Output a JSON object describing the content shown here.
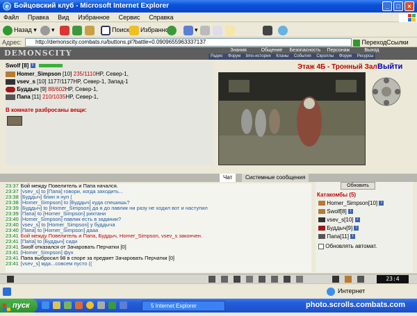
{
  "window": {
    "title": "Бойцовский клуб - Microsoft Internet Explorer"
  },
  "menu": [
    "Файл",
    "Правка",
    "Вид",
    "Избранное",
    "Сервис",
    "Справка"
  ],
  "toolbar": {
    "back_label": "Назад",
    "search_label": "Поиск",
    "favorites_label": "Избранное"
  },
  "address": {
    "label": "Адрес:",
    "url": "http://demonscity.combats.ru/buttons.pl?battle=0.0909655963337137",
    "go_label": "Переход",
    "links_label": "Ссылки"
  },
  "game_nav": {
    "logo": "DEMONSCITY",
    "top_links": [
      "Знания",
      "Общение",
      "Безопасность",
      "Персонаж",
      "Выход"
    ],
    "bottom_links": [
      "Радио",
      "Форум",
      "bms-история",
      "Кланы",
      "События",
      "Скроллы",
      "Форум",
      "Ресурсы"
    ]
  },
  "location": {
    "title": "Этаж 4Б - Тронный Зал",
    "exit_label": "Выйти"
  },
  "party": {
    "header_name": "Swolf [8]",
    "members": [
      {
        "name": "Homer_Simpson",
        "level": "[10]",
        "hp": "235/1110",
        "hp_suffix": "HP, Север-1,",
        "hp_low": true
      },
      {
        "name": "vsev_s",
        "level": "[10]",
        "hp": "1177/1177",
        "hp_suffix": "HP, Север-1, Запад-1",
        "hp_low": false
      },
      {
        "name": "Буддыч",
        "level": "[9]",
        "hp": "88/602",
        "hp_suffix": "HP, Север-1,",
        "hp_low": true
      },
      {
        "name": "Папа",
        "level": "[11]",
        "hp": "210/1035",
        "hp_suffix": "HP, Север-1,",
        "hp_low": true
      }
    ],
    "items_header": "В комнате разбросаны вещи:"
  },
  "chat_tabs": {
    "chat": "Чат",
    "system": "Системные сообщения"
  },
  "chat_lines": [
    {
      "time": "23:37",
      "text": "Бой между Повелитель и Папа начался.",
      "cls": ""
    },
    {
      "time": "23:37",
      "text": "[vsev_s] to [Папа] говори, когда заходить...",
      "cls": "m"
    },
    {
      "time": "23:38",
      "text": "[Буддыч] блин я нуп (",
      "cls": "m"
    },
    {
      "time": "23:38",
      "text": "[Homer_Simpson] to [Буддыч] куда спешишь?",
      "cls": "m"
    },
    {
      "time": "23:39",
      "text": "[Буддыч] to [Homer_Simpson] да я до павлик ни разу не ходил вот и наступил",
      "cls": "m"
    },
    {
      "time": "23:39",
      "text": "[Папа] to [Homer_Simpson] рихтани",
      "cls": "m"
    },
    {
      "time": "23:40",
      "text": "[Homer_Simpson] павлик есть в задании?",
      "cls": "m"
    },
    {
      "time": "23:40",
      "text": "[vsev_s] to [Homer_Simpson] у буддыча",
      "cls": "m"
    },
    {
      "time": "23:40",
      "text": "[Папа] to [Homer_Simpson] дааа",
      "cls": "m"
    },
    {
      "time": "23:41",
      "text": "Бой между Повелитель и Папа, Буддыч, Homer_Simpson, vsev_s закончен.",
      "cls": "red"
    },
    {
      "time": "23:41",
      "text": "[Папа] to [Буддыч] сиди",
      "cls": "m"
    },
    {
      "time": "23:41",
      "text": "Swolf отказался от Зачаровать Перчатки [0]",
      "cls": ""
    },
    {
      "time": "23:41",
      "text": "[Homer_Simpson] фух",
      "cls": "m"
    },
    {
      "time": "23:41",
      "text": "Папа выбросил 98 в споре за предмет Зачаровать Перчатки [0]",
      "cls": ""
    },
    {
      "time": "23:41",
      "text": "[vsev_s] мда...совсем пусто ((",
      "cls": "m"
    }
  ],
  "right_panel": {
    "refresh_label": "Обновить",
    "location_name": "Катакомбы (5)",
    "players": [
      {
        "name": "Homer_Simpson",
        "level": "[10]"
      },
      {
        "name": "Swolf",
        "level": "[8]"
      },
      {
        "name": "vsev_s",
        "level": "[10]"
      },
      {
        "name": "Буддыч",
        "level": "[9]"
      },
      {
        "name": "Папа",
        "level": "[11]"
      }
    ],
    "auto_refresh_label": "Обновлять автомат."
  },
  "bottom_clock": "23:4",
  "status": {
    "text": "Интернет"
  },
  "taskbar": {
    "start_label": "пуск",
    "task_label": "5 Internet Explorer",
    "watermark": "photo.scrolls.combats.com"
  },
  "colors": {
    "xp_blue": "#0a52d8",
    "hp_red": "#c00000",
    "chat_time_green": "#007a00"
  }
}
